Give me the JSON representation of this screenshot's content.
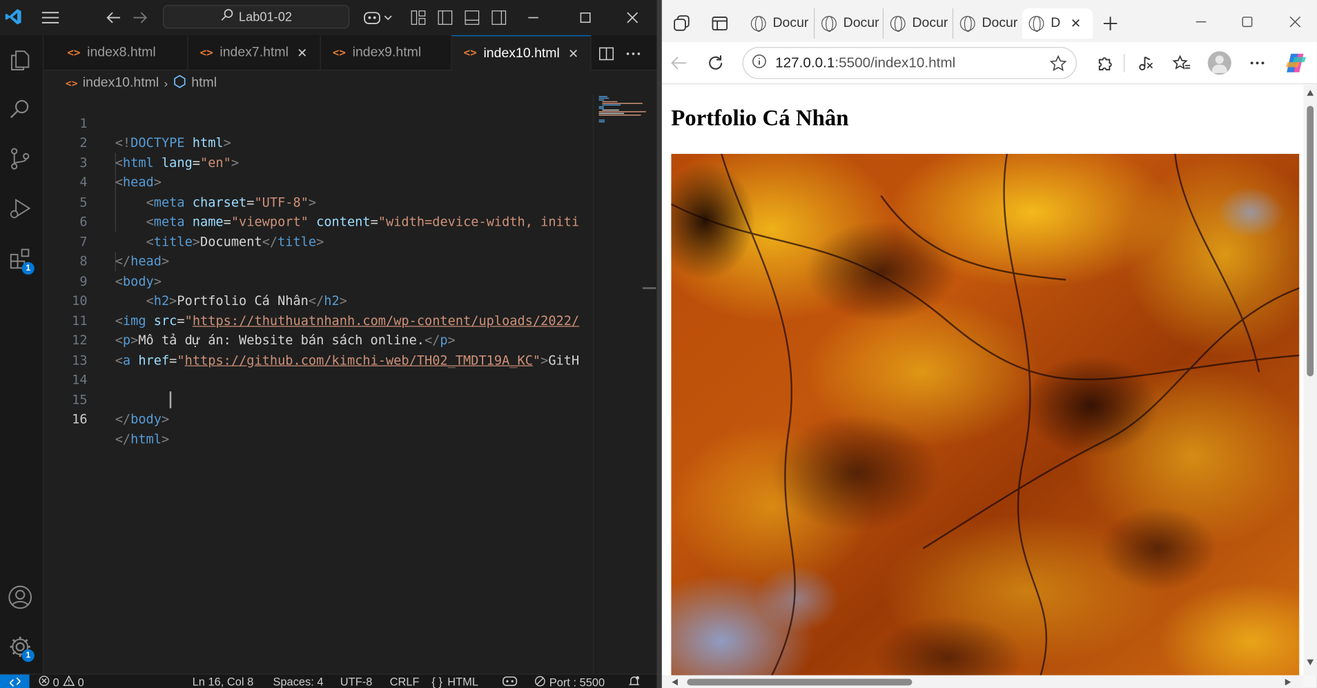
{
  "vscode": {
    "search_text": "Lab01-02",
    "tabs": [
      {
        "label": "index8.html"
      },
      {
        "label": "index7.html"
      },
      {
        "label": "index9.html"
      },
      {
        "label": "index10.html"
      }
    ],
    "breadcrumb": {
      "file": "index10.html",
      "symbol": "html"
    },
    "badges": {
      "extensions": "1",
      "settings": "1"
    },
    "line_numbers": [
      "1",
      "2",
      "3",
      "4",
      "5",
      "6",
      "7",
      "8",
      "9",
      "10",
      "11",
      "12",
      "13",
      "14",
      "15",
      "16"
    ],
    "code": {
      "l1": {
        "br1": "<!",
        "tag": "DOCTYPE",
        "at": "html",
        "br2": ">"
      },
      "l2": {
        "br1": "<",
        "tag": "html",
        "at": "lang",
        "eq": "=",
        "str": "\"en\"",
        "br2": ">"
      },
      "l3": {
        "br1": "<",
        "tag": "head",
        "br2": ">"
      },
      "l4": {
        "br1": "<",
        "tag": "meta",
        "at": "charset",
        "eq": "=",
        "str": "\"UTF-8\"",
        "br2": ">"
      },
      "l5": {
        "br1": "<",
        "tag": "meta",
        "at1": "name",
        "eq1": "=",
        "str1": "\"viewport\"",
        "at2": "content",
        "eq2": "=",
        "str2": "\"width=device-width, initi"
      },
      "l6": {
        "br1": "<",
        "tag": "title",
        "br2": ">",
        "txt": "Document",
        "br3": "</",
        "tag2": "title",
        "br4": ">"
      },
      "l7": {
        "br1": "</",
        "tag": "head",
        "br2": ">"
      },
      "l8": {
        "br1": "<",
        "tag": "body",
        "br2": ">"
      },
      "l9": {
        "br1": "<",
        "tag": "h2",
        "br2": ">",
        "txt": "Portfolio Cá Nhân",
        "br3": "</",
        "tag2": "h2",
        "br4": ">"
      },
      "l10": {
        "br1": "<",
        "tag": "img",
        "at": "src",
        "eq": "=",
        "q": "\"",
        "link": "https://thuthuatnhanh.com/wp-content/uploads/2022/"
      },
      "l11": {
        "br1": "<",
        "tag": "p",
        "br2": ">",
        "txt": "Mô tả dự án: Website bán sách online.",
        "br3": "</",
        "tag2": "p",
        "br4": ">"
      },
      "l12": {
        "br1": "<",
        "tag": "a",
        "at": "href",
        "eq": "=",
        "q": "\"",
        "link": "https://github.com/kimchi-web/TH02_TMDT19A_KC",
        "q2": "\"",
        "br2": ">",
        "txt": "GitH"
      },
      "l15": {
        "br1": "</",
        "tag": "body",
        "br2": ">"
      },
      "l16": {
        "br1": "</",
        "tag": "html",
        "br2": ">"
      }
    },
    "status": {
      "errors": "0",
      "warnings": "0",
      "position": "Ln 16, Col 8",
      "spaces": "Spaces: 4",
      "encoding": "UTF-8",
      "eol": "CRLF",
      "language": "HTML",
      "port": "Port : 5500"
    }
  },
  "browser": {
    "tabs": [
      {
        "label": "Docur"
      },
      {
        "label": "Docur"
      },
      {
        "label": "Docur"
      },
      {
        "label": "Docur"
      },
      {
        "label": "D"
      }
    ],
    "url_host": "127.0.0.1",
    "url_rest": ":5500/index10.html",
    "page_heading": "Portfolio Cá Nhân"
  },
  "colors": {
    "accent": "#0078d4",
    "html_icon": "#e37933",
    "editor_bg": "#1f1f1f"
  }
}
